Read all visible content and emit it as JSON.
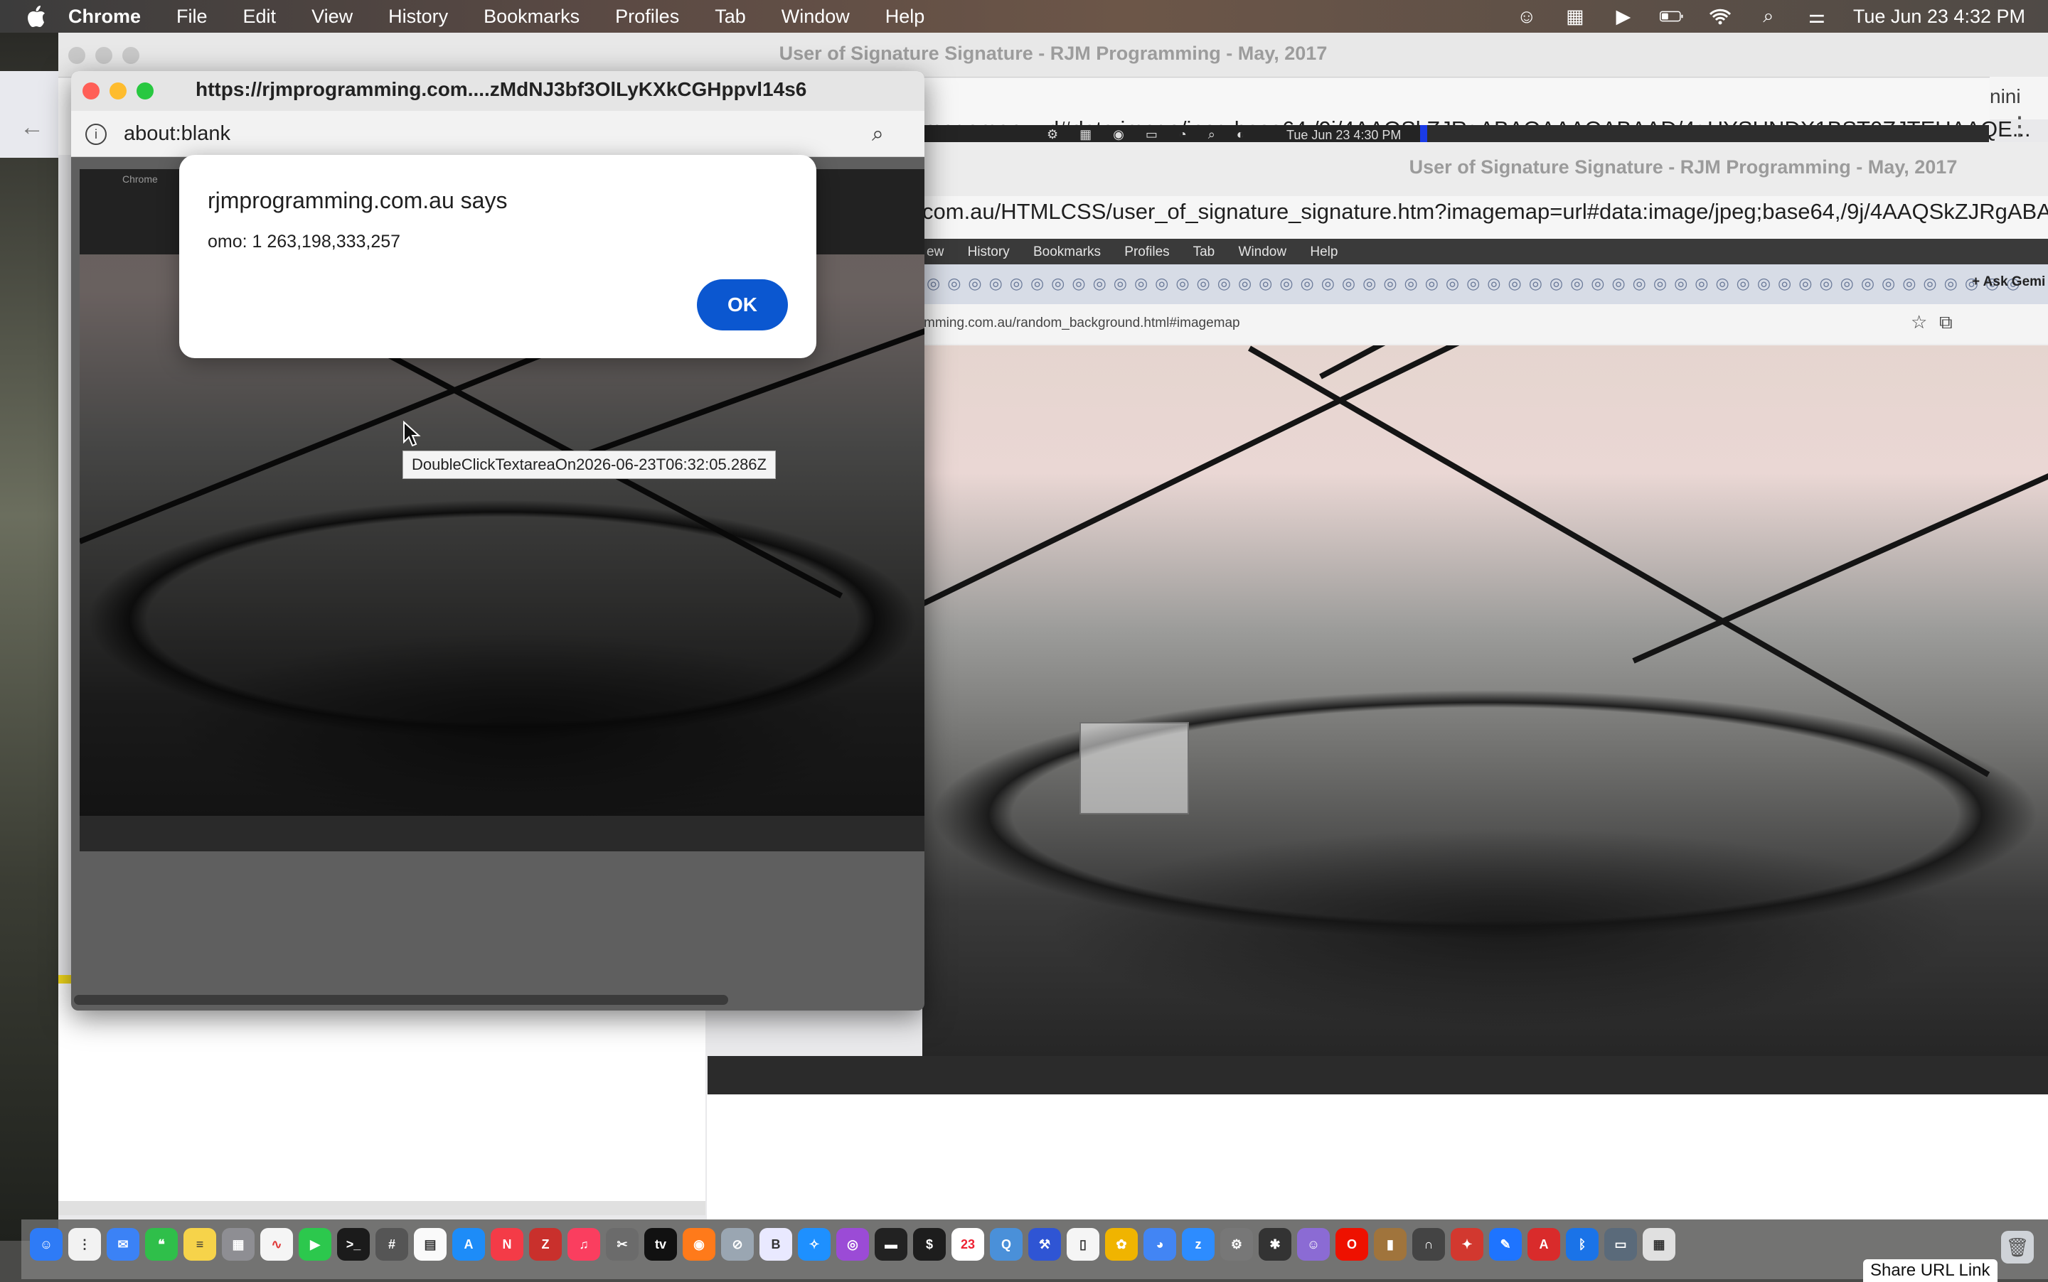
{
  "menubar": {
    "app": "Chrome",
    "items": [
      "File",
      "Edit",
      "View",
      "History",
      "Bookmarks",
      "Profiles",
      "Tab",
      "Window",
      "Help"
    ],
    "clock": "Tue Jun 23  4:32 PM"
  },
  "back_window": {
    "title": "User of Signature Signature - RJM Programming - May, 2017",
    "url": "imagemap=url#data:image/jpeg;base64,/9j/4AAQSkZJRgABAQAAAQABAAD/4gHYSUNDX1BST0ZJTEUAAQE...",
    "side_tab": "nini",
    "inner_clock": "Tue Jun 23  4:30 PM"
  },
  "right_window": {
    "title": "User of Signature Signature - RJM Programming - May, 2017",
    "url": "com.au/HTMLCSS/user_of_signature_signature.htm?imagemap=url#data:image/jpeg;base64,/9j/4AAQSkZJRgABAQAAA",
    "menu": [
      "ew",
      "History",
      "Bookmarks",
      "Profiles",
      "Tab",
      "Window",
      "Help"
    ],
    "address": "mming.com.au/random_background.html#imagemap",
    "ask_gemini": "Ask Gemi"
  },
  "popup": {
    "title": "https://rjmprogramming.com....zMdNJ3bf3OlLyKXkCGHppvl14s6",
    "address": "about:blank",
    "inner_app": "Chrome"
  },
  "alert": {
    "heading": "rjmprogramming.com.au says",
    "message": "omo: 1 263,198,333,257",
    "ok_label": "OK"
  },
  "tooltip": "DoubleClickTextareaOn2026-06-23T06:32:05.286Z",
  "dock": {
    "calendar_day": "23",
    "tv_label": "tv",
    "share_link": "Share URL Link"
  },
  "colors": {
    "accent": "#0b57d0",
    "traffic_red": "#ff5f57",
    "traffic_yellow": "#febc2e",
    "traffic_green": "#28c840"
  }
}
